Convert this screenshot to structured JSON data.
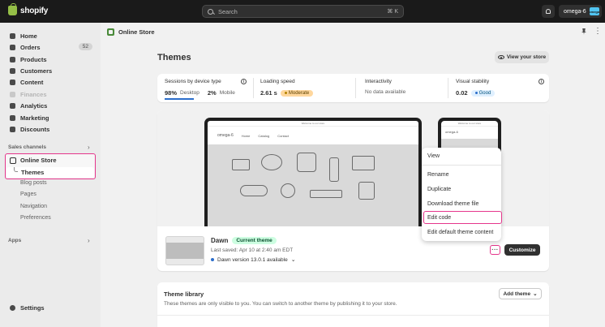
{
  "topbar": {
    "brand": "shopify",
    "search_placeholder": "Search",
    "search_shortcut": "⌘ K",
    "store_name": "omega-6",
    "store_avatar": "omega"
  },
  "sidebar": {
    "items": [
      {
        "label": "Home",
        "icon": "home-icon"
      },
      {
        "label": "Orders",
        "icon": "orders-icon",
        "badge": "52"
      },
      {
        "label": "Products",
        "icon": "products-icon"
      },
      {
        "label": "Customers",
        "icon": "customers-icon"
      },
      {
        "label": "Content",
        "icon": "content-icon"
      },
      {
        "label": "Finances",
        "icon": "finances-icon"
      },
      {
        "label": "Analytics",
        "icon": "analytics-icon"
      },
      {
        "label": "Marketing",
        "icon": "marketing-icon"
      },
      {
        "label": "Discounts",
        "icon": "discounts-icon"
      }
    ],
    "sales_channels_label": "Sales channels",
    "online_store": "Online Store",
    "themes": "Themes",
    "sub_items": [
      "Blog posts",
      "Pages",
      "Navigation",
      "Preferences"
    ],
    "apps_label": "Apps",
    "settings": "Settings"
  },
  "main": {
    "header_title": "Online Store",
    "page_title": "Themes",
    "view_store": "View your store",
    "metrics": {
      "sessions_label": "Sessions by device type",
      "desktop_pct": "98%",
      "desktop_label": "Desktop",
      "mobile_pct": "2%",
      "mobile_label": "Mobile",
      "loading_label": "Loading speed",
      "loading_value": "2.61 s",
      "loading_pill": "Moderate",
      "interactivity_label": "Interactivity",
      "interactivity_value": "No data available",
      "visual_label": "Visual stability",
      "visual_value": "0.02",
      "visual_pill": "Good"
    },
    "preview": {
      "laptop_announcement": "Welcome to our store",
      "laptop_brand": "omega-6",
      "laptop_nav": [
        "Home",
        "Catalog",
        "Contact"
      ],
      "phone_announcement": "Welcome to our store",
      "phone_brand": "omega-6"
    },
    "theme": {
      "name": "Dawn",
      "status": "Current theme",
      "saved": "Last saved: Apr 10 at 2:40 am EDT",
      "version": "Dawn version 13.0.1 available",
      "more_button": "···",
      "customize": "Customize"
    },
    "menu": {
      "items": [
        "View",
        "Rename",
        "Duplicate",
        "Download theme file",
        "Edit code",
        "Edit default theme content"
      ]
    },
    "library": {
      "title": "Theme library",
      "description": "These themes are only visible to you. You can switch to another theme by publishing it to your store.",
      "add_theme": "Add theme"
    }
  },
  "colors": {
    "topbar": "#1a1a1a",
    "highlight": "#e5368c",
    "current_pill": "#cdfee1",
    "moderate_pill": "#ffd79d",
    "good_pill": "#e0f0ff"
  }
}
